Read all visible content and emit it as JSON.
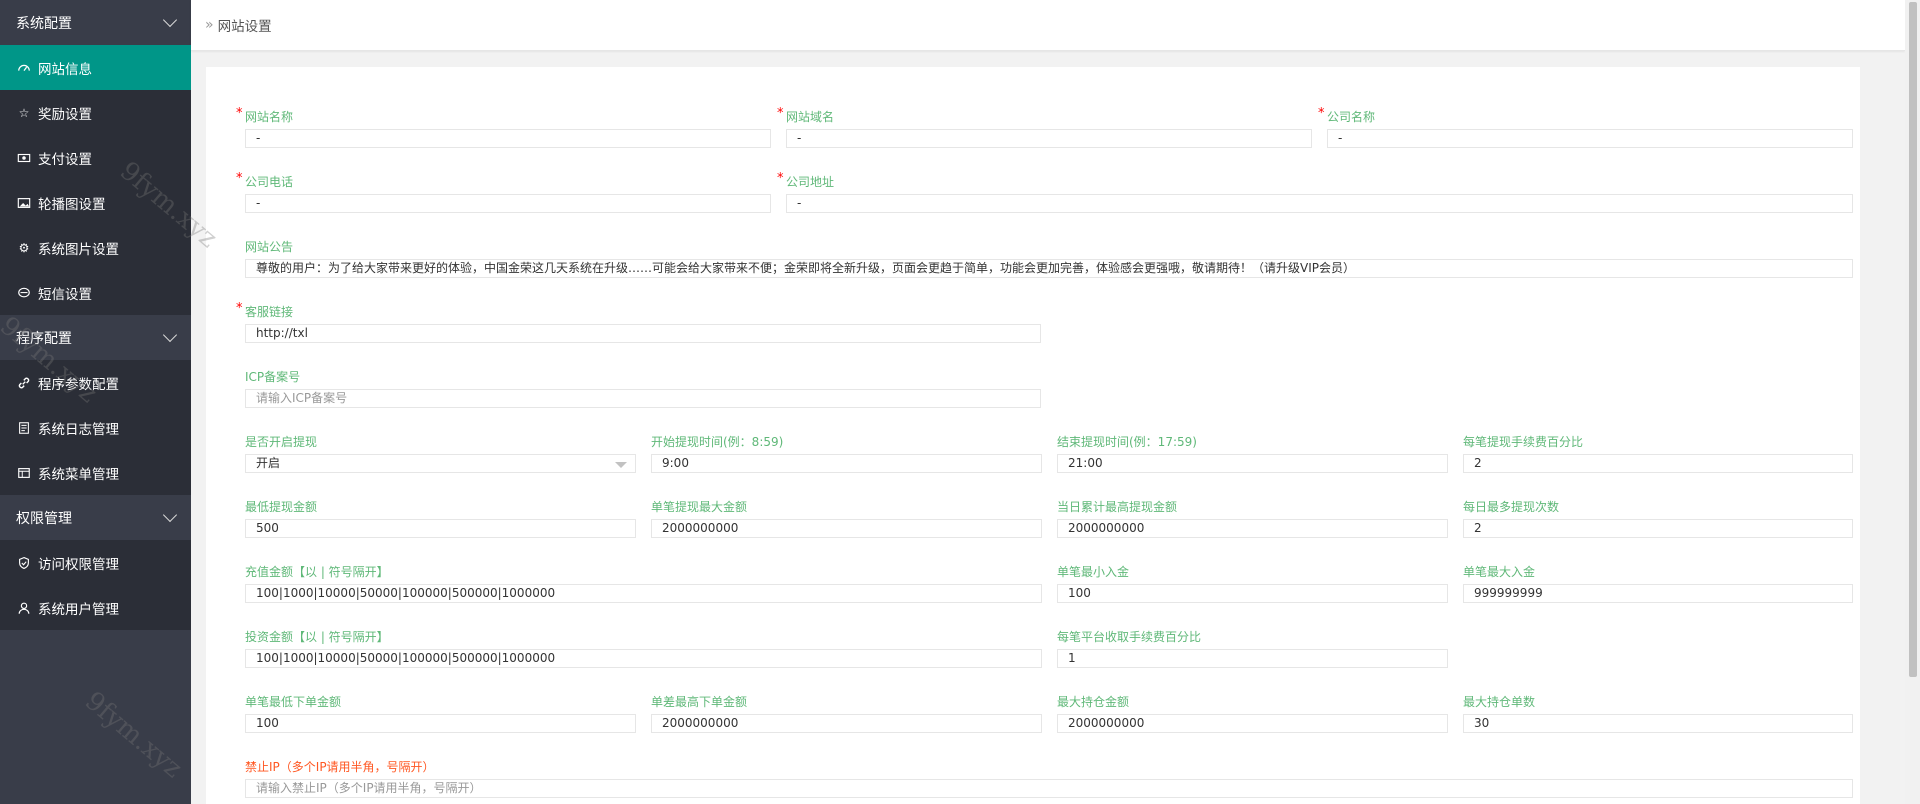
{
  "sidebar": {
    "groups": [
      {
        "label": "系统配置",
        "items": [
          "网站信息",
          "奖励设置",
          "支付设置",
          "轮播图设置",
          "系统图片设置",
          "短信设置"
        ]
      },
      {
        "label": "程序配置",
        "items": [
          "程序参数配置",
          "系统日志管理",
          "系统菜单管理"
        ]
      },
      {
        "label": "权限管理",
        "items": [
          "访问权限管理",
          "系统用户管理"
        ]
      }
    ]
  },
  "header": {
    "breadcrumb": "网站设置"
  },
  "form": {
    "site_name": {
      "label": "网站名称",
      "value": "-"
    },
    "site_domain": {
      "label": "网站域名",
      "value": "-"
    },
    "company_name": {
      "label": "公司名称",
      "value": "-"
    },
    "company_phone": {
      "label": "公司电话",
      "value": "-"
    },
    "company_address": {
      "label": "公司地址",
      "value": "-"
    },
    "notice": {
      "label": "网站公告",
      "value": "尊敬的用户：为了给大家带来更好的体验，中国金荣这几天系统在升级……可能会给大家带来不便；金荣即将全新升级，页面会更趋于简单，功能会更加完善，体验感会更强哦，敬请期待！（请升级VIP会员）"
    },
    "service_link": {
      "label": "客服链接",
      "value": "http://txl"
    },
    "icp": {
      "label": "ICP备案号",
      "placeholder": "请输入ICP备案号"
    },
    "withdraw_enabled": {
      "label": "是否开启提现",
      "value": "开启"
    },
    "withdraw_start": {
      "label": "开始提现时间(例：8:59)",
      "value": "9:00"
    },
    "withdraw_end": {
      "label": "结束提现时间(例：17:59)",
      "value": "21:00"
    },
    "withdraw_fee": {
      "label": "每笔提现手续费百分比",
      "value": "2"
    },
    "min_withdraw": {
      "label": "最低提现金额",
      "value": "500"
    },
    "max_withdraw_single": {
      "label": "单笔提现最大金额",
      "value": "2000000000"
    },
    "max_withdraw_daily": {
      "label": "当日累计最高提现金额",
      "value": "2000000000"
    },
    "max_withdraw_count": {
      "label": "每日最多提现次数",
      "value": "2"
    },
    "recharge_amounts": {
      "label": "充值金额【以 | 符号隔开】",
      "value": "100|1000|10000|50000|100000|500000|1000000"
    },
    "min_deposit": {
      "label": "单笔最小入金",
      "value": "100"
    },
    "max_deposit": {
      "label": "单笔最大入金",
      "value": "999999999"
    },
    "invest_amounts": {
      "label": "投资金额【以 | 符号隔开】",
      "value": "100|1000|10000|50000|100000|500000|1000000"
    },
    "platform_fee": {
      "label": "每笔平台收取手续费百分比",
      "value": "1"
    },
    "min_order": {
      "label": "单笔最低下单金额",
      "value": "100"
    },
    "max_order": {
      "label": "单差最高下单金额",
      "value": "2000000000"
    },
    "max_position_amount": {
      "label": "最大持仓金额",
      "value": "2000000000"
    },
    "max_position_count": {
      "label": "最大持仓单数",
      "value": "30"
    },
    "ban_ip": {
      "label": "禁止IP（多个IP请用半角，号隔开）",
      "placeholder": "请输入禁止IP（多个IP请用半角，号隔开）"
    }
  },
  "watermark": "9fym.xyz"
}
